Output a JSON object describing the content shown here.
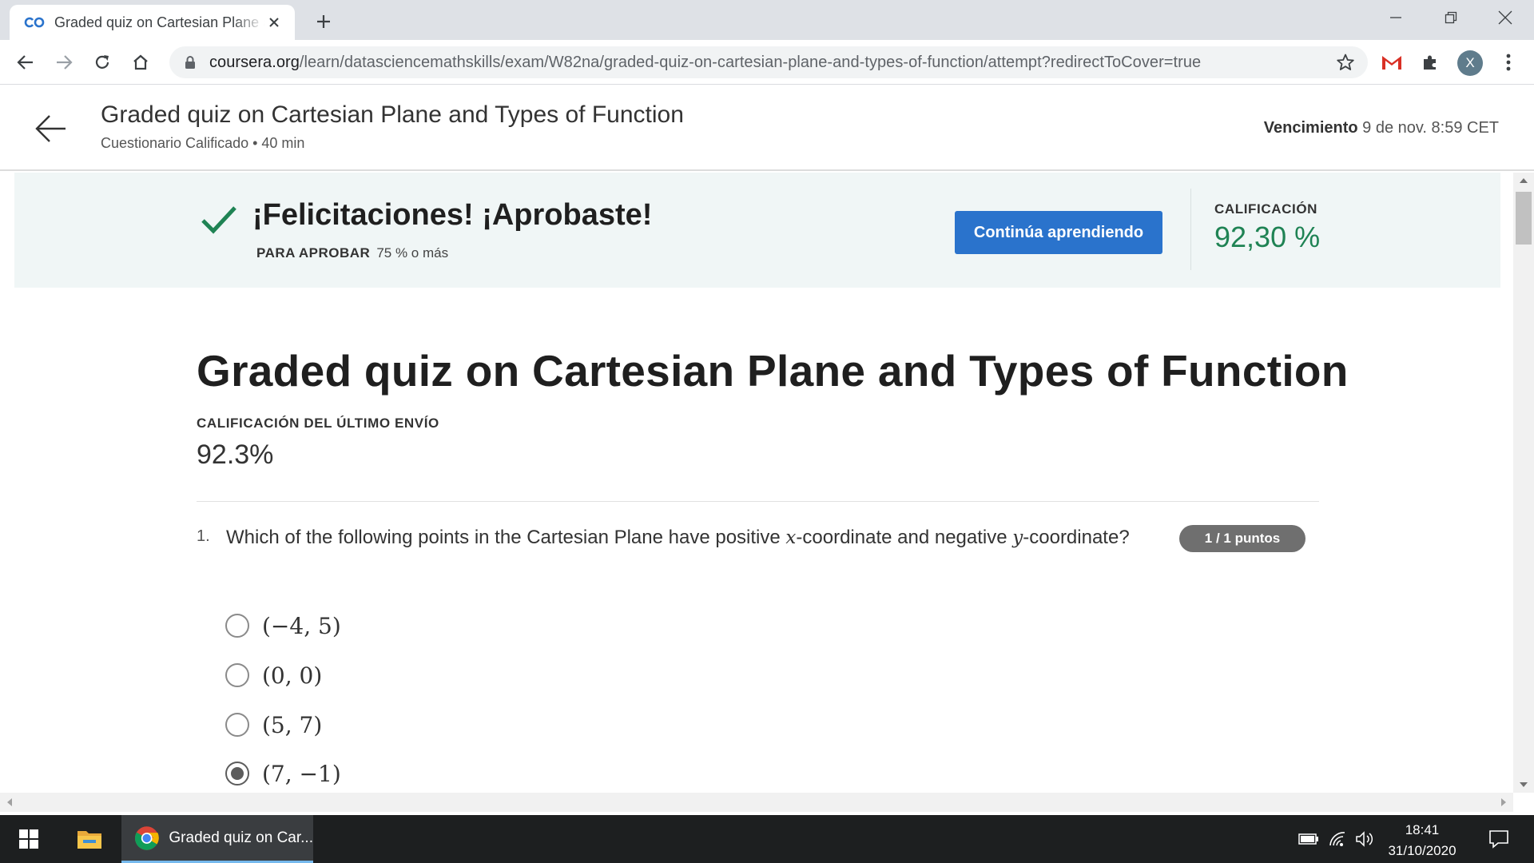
{
  "browser": {
    "tab_title": "Graded quiz on Cartesian Plane and Types of Function",
    "url_host": "coursera.org",
    "url_path": "/learn/datasciencemathskills/exam/W82na/graded-quiz-on-cartesian-plane-and-types-of-function/attempt?redirectToCover=true",
    "profile_initial": "X",
    "icons": [
      "coursera-favicon",
      "close-icon",
      "new-tab-icon",
      "minimize-icon",
      "restore-icon",
      "window-close-icon",
      "back-icon",
      "forward-icon",
      "reload-icon",
      "home-icon",
      "lock-icon",
      "star-icon",
      "gmail-icon",
      "extensions-icon",
      "menu-icon"
    ]
  },
  "header": {
    "title": "Graded quiz on Cartesian Plane and Types of Function",
    "subtitle": "Cuestionario Calificado • 40 min",
    "due_label": "Vencimiento",
    "due_value": "9 de nov. 8:59 CET"
  },
  "banner": {
    "message": "¡Felicitaciones! ¡Aprobaste!",
    "pass_label": "PARA APROBAR",
    "pass_value": "75 % o más",
    "continue_label": "Continúa aprendiendo",
    "grade_label": "CALIFICACIÓN",
    "grade_value": "92,30 %"
  },
  "main": {
    "title": "Graded quiz on Cartesian Plane and Types of Function",
    "last_submission_label": "CALIFICACIÓN DEL ÚLTIMO ENVÍO",
    "last_submission_value": "92.3%"
  },
  "question": {
    "number": "1.",
    "text_part1": "Which of the following points in the Cartesian Plane have positive ",
    "var_x": "x",
    "text_part2": "-coordinate and negative ",
    "var_y": "y",
    "text_part3": "-coordinate?",
    "points": "1 / 1 puntos",
    "options": [
      {
        "label": "(−4, 5)",
        "selected": false
      },
      {
        "label": "(0, 0)",
        "selected": false
      },
      {
        "label": "(5, 7)",
        "selected": false
      },
      {
        "label": "(7, −1)",
        "selected": true
      }
    ]
  },
  "taskbar": {
    "active_app_label": "Graded quiz on Car...",
    "time": "18:41",
    "date": "31/10/2020"
  },
  "colors": {
    "accent_blue": "#2a73cc",
    "success_green": "#1f8354",
    "banner_bg": "#f0f6f6",
    "badge_gray": "#6f6f6f"
  }
}
